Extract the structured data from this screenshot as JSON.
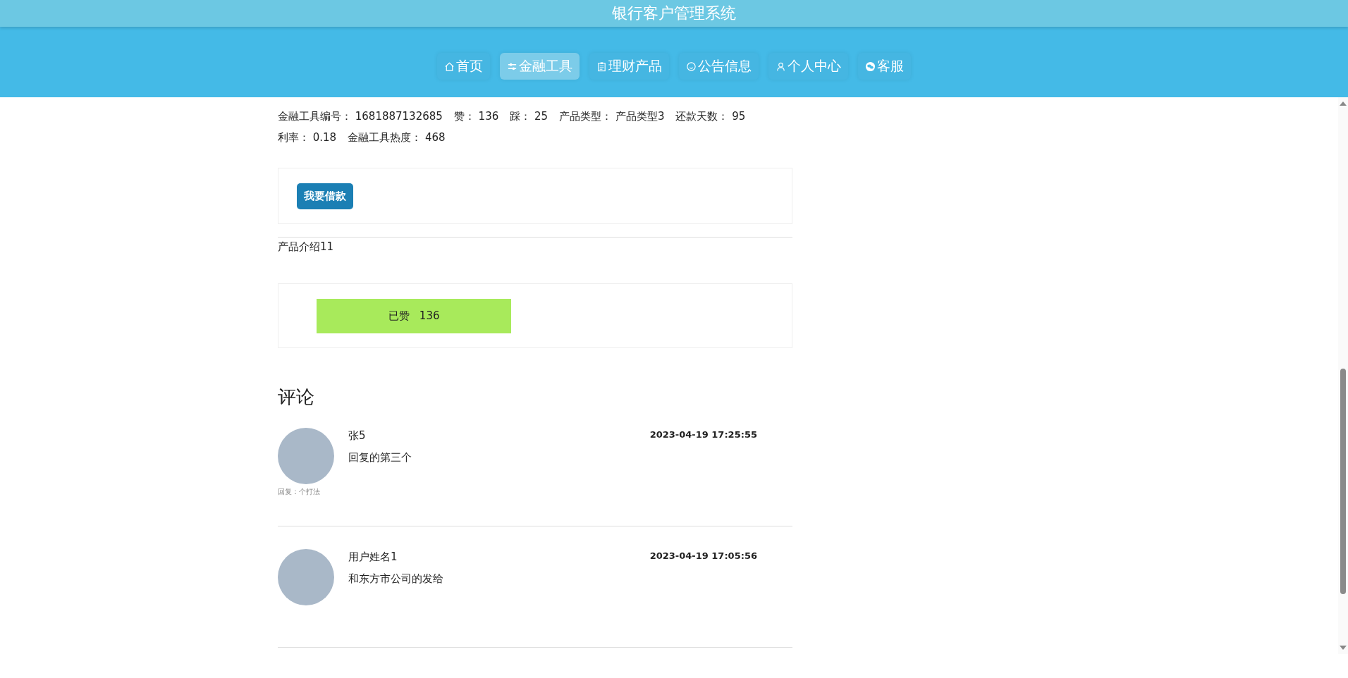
{
  "site_title": "银行客户管理系统",
  "nav": [
    {
      "label": "首页",
      "kind": "home",
      "selected": false
    },
    {
      "label": "金融工具",
      "kind": "sliders",
      "selected": true
    },
    {
      "label": "理财产品",
      "kind": "clipboard",
      "selected": false
    },
    {
      "label": "公告信息",
      "kind": "smile",
      "selected": false
    },
    {
      "label": "个人中心",
      "kind": "user",
      "selected": false
    },
    {
      "label": "客服",
      "kind": "chat",
      "selected": false
    }
  ],
  "info_lines": [
    [
      {
        "label": "金融工具编号：",
        "value": "1681887132685"
      },
      {
        "label": "赞：",
        "value": "136"
      },
      {
        "label": "踩：",
        "value": "25"
      },
      {
        "label": "产品类型：",
        "value": "产品类型3"
      },
      {
        "label": "还款天数：",
        "value": "95"
      }
    ],
    [
      {
        "label": "利率：",
        "value": "0.18"
      },
      {
        "label": "金融工具热度：",
        "value": "468"
      }
    ]
  ],
  "loan_button": "我要借款",
  "description": "产品介绍11",
  "like": {
    "label": "已赞",
    "count": "136"
  },
  "comments_title": "评论",
  "comments": [
    {
      "name": "张5",
      "time": "2023-04-19 17:25:55",
      "text": "回复的第三个",
      "reply": "回复：个打法"
    },
    {
      "name": "用户姓名1",
      "time": "2023-04-19 17:05:56",
      "text": "和东方市公司的发给"
    }
  ]
}
